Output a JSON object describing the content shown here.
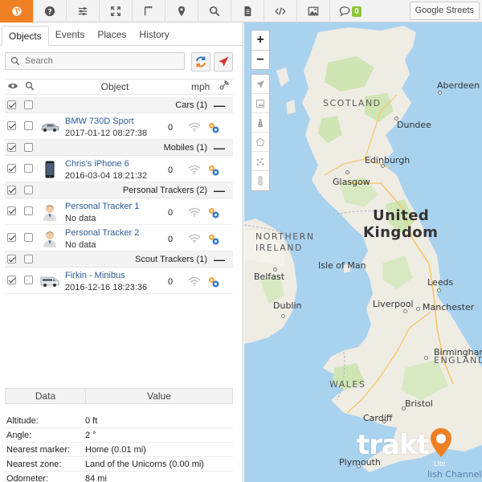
{
  "toolbar": {
    "buttons": [
      "globe-icon",
      "help-icon",
      "sliders-icon",
      "fullscreen-icon",
      "ruler-icon",
      "marker-icon",
      "search-icon",
      "document-icon",
      "code-icon",
      "image-icon",
      "chat-icon"
    ],
    "chat_badge": "0",
    "map_layer": "Google Streets"
  },
  "tabs": [
    "Objects",
    "Events",
    "Places",
    "History"
  ],
  "search": {
    "placeholder": "Search"
  },
  "objects_table": {
    "col_object": "Object",
    "col_speed": "mph"
  },
  "groups": [
    {
      "name": "Cars (1)",
      "collapse": "—",
      "items": [
        {
          "name": "BMW 730D Sport",
          "date": "2017-01-12 08:27:38",
          "speed": "0",
          "icon": "car-icon"
        }
      ]
    },
    {
      "name": "Mobiles (1)",
      "collapse": "—",
      "items": [
        {
          "name": "Chris's iPhone 6",
          "date": "2016-03-04 18:21:32",
          "speed": "0",
          "icon": "phone-icon"
        }
      ]
    },
    {
      "name": "Personal Trackers (2)",
      "collapse": "—",
      "items": [
        {
          "name": "Personal Tracker 1",
          "date": "No data",
          "speed": "0",
          "icon": "person-icon"
        },
        {
          "name": "Personal Tracker 2",
          "date": "No data",
          "speed": "0",
          "icon": "person-icon"
        }
      ]
    },
    {
      "name": "Scout Trackers (1)",
      "collapse": "—",
      "items": [
        {
          "name": "Firkin - Minibus",
          "date": "2016-12-16 18:23:36",
          "speed": "0",
          "icon": "van-icon"
        }
      ]
    }
  ],
  "data_panel": {
    "col_data": "Data",
    "col_value": "Value",
    "rows": [
      {
        "label": "Altitude:",
        "value": "0 ft"
      },
      {
        "label": "Angle:",
        "value": "2 °"
      },
      {
        "label": "Nearest marker:",
        "value": "Home (0.01 mi)"
      },
      {
        "label": "Nearest zone:",
        "value": "Land of the Unicorns (0.00 mi)"
      },
      {
        "label": "Odometer:",
        "value": "84 mi"
      }
    ]
  },
  "map": {
    "zoom_in": "+",
    "zoom_out": "−",
    "labels": {
      "scotland": "SCOTLAND",
      "united": "United",
      "kingdom": "Kingdom",
      "northern": "NORTHERN",
      "ireland": "IRELAND",
      "isle_of_man": "Isle of Man",
      "wales": "WALES",
      "england": "ENGLAND",
      "channel": "lish Channel"
    },
    "cities": [
      "Aberdeen",
      "Dundee",
      "Edinburgh",
      "Glasgow",
      "Belfast",
      "Dublin",
      "Leeds",
      "Liverpool",
      "Manchester",
      "Birmingham",
      "Cardiff",
      "Bristol",
      "Plymouth"
    ],
    "logo": "trakt",
    "logo_sub": "Lite"
  }
}
